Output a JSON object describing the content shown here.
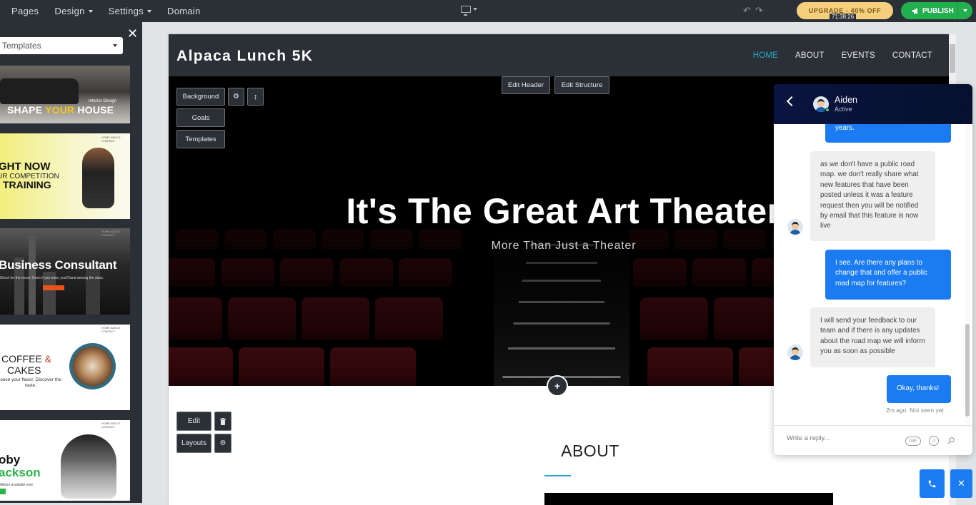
{
  "topbar": {
    "nav": [
      "Pages",
      "Design",
      "Settings",
      "Domain"
    ],
    "upgrade_label": "UPGRADE - 40% OFF",
    "timer": "71:38:26",
    "publish_label": "PUBLISH"
  },
  "left_panel": {
    "close": "✕",
    "select_value": "Templates",
    "templates": {
      "t1_small": "Interior Design",
      "t1_big_a": "SHAPE ",
      "t1_big_b": "YOUR",
      "t1_big_c": " HOUSE",
      "t2_l1": "GHT NOW",
      "t2_l2": "UR COMPETITION",
      "t2_l3": "TRAINING",
      "t3_title": "Business Consultant",
      "t3_sub": "Shoot for the moon. Even if you miss, you'll land among the stars.",
      "t4_l1a": "COFFEE ",
      "t4_l1b": "&",
      "t4_l2": "CAKES",
      "t4_l3": "oose your flavor. Discover the taste.",
      "t5_l1": "oby",
      "t5_l2": "ackson",
      "t5_l3": "Album available now",
      "nav_small": "HOME  ABOUT  CONTACT"
    }
  },
  "site": {
    "logo": "Alpaca Lunch 5K",
    "nav": [
      "HOME",
      "ABOUT",
      "EVENTS",
      "CONTACT"
    ],
    "hero_title": "It's The Great Art Theater",
    "hero_subtitle": "More Than Just a Theater",
    "about_title": "ABOUT"
  },
  "editor": {
    "edit_header": "Edit Header",
    "edit_structure": "Edit Structure",
    "background": "Background",
    "goals": "Goals",
    "templates": "Templates",
    "edit": "Edit",
    "layouts": "Layouts",
    "add": "+"
  },
  "chat": {
    "agent_name": "Aiden",
    "agent_status": "Active",
    "messages": [
      {
        "from": "me",
        "text": "years."
      },
      {
        "from": "bot",
        "text": "as we don't have a public road map. we don't really share what new features that have been posted unless it was a feature request then you will be notified by email that this feature is now live"
      },
      {
        "from": "me",
        "text": "I see. Are there any plans to change that and offer a public road map for features?"
      },
      {
        "from": "bot",
        "text": "I will send your feedback to our team and if there is any updates about the road map we will inform you as soon as possible"
      },
      {
        "from": "me",
        "text": "Okay, thanks!"
      }
    ],
    "meta": "2m ago. Not seen yet",
    "input_placeholder": "Write a reply...",
    "gif_label": "GIF"
  },
  "icons": {
    "device": "desktop-icon",
    "undo": "undo-icon",
    "redo": "redo-icon",
    "megaphone": "megaphone-icon",
    "gear": "gear-icon",
    "resize": "resize-icon",
    "trash": "trash-icon",
    "phone": "phone-icon",
    "close": "close-icon"
  },
  "colors": {
    "topbar": "#2b3036",
    "accent": "#26a9c9",
    "publish": "#22b04f",
    "upgrade": "#f5cf7c",
    "chat_bubble": "#1a7bf2",
    "chat_header": "#0a1440"
  }
}
